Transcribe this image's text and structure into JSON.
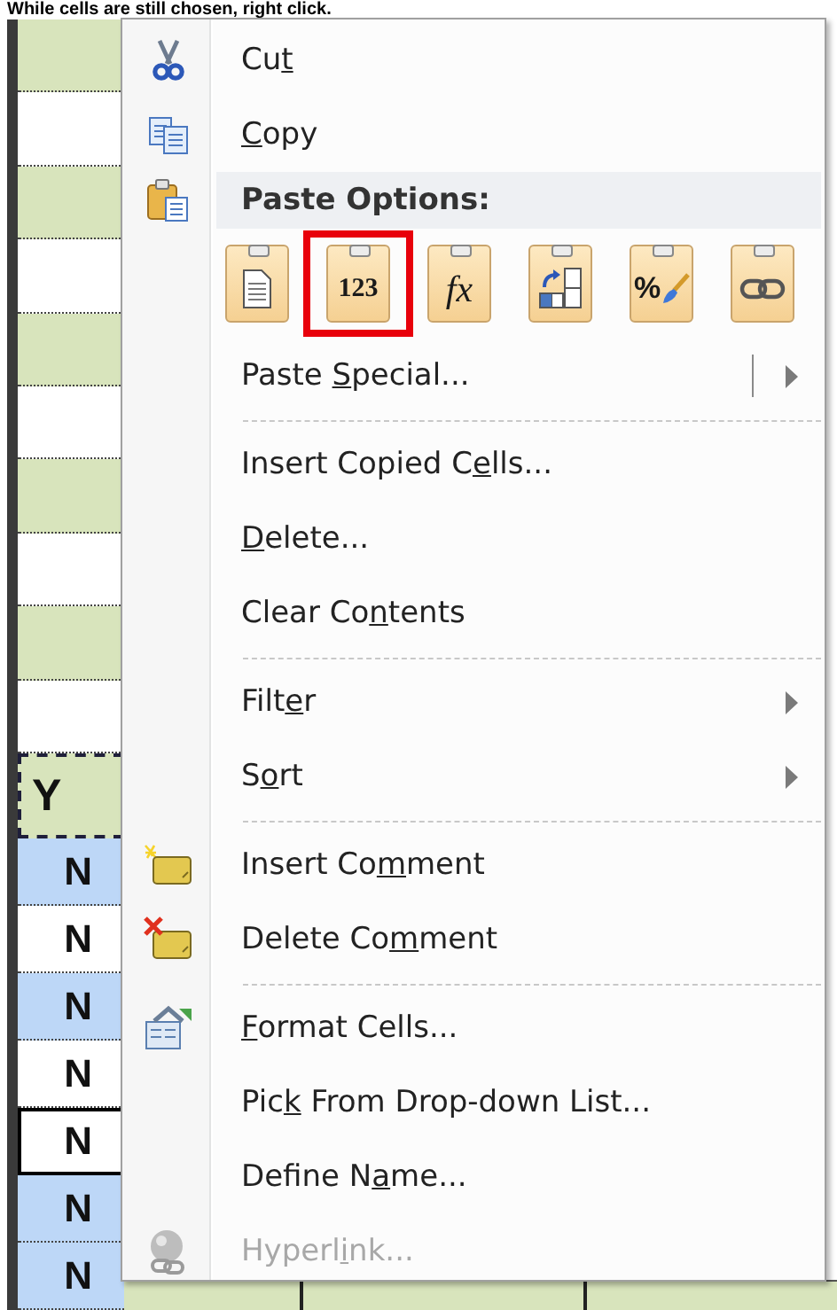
{
  "caption": "While cells are still chosen, right click.",
  "sheet": {
    "rows": [
      {
        "kind": "blank",
        "color": "#d8e4bc",
        "active": false,
        "copied": false
      },
      {
        "kind": "blank",
        "color": "#ffffff",
        "active": false,
        "copied": false
      },
      {
        "kind": "blank",
        "color": "#d8e4bc",
        "active": false,
        "copied": false
      },
      {
        "kind": "blank",
        "color": "#ffffff",
        "active": false,
        "copied": false
      },
      {
        "kind": "blank",
        "color": "#d8e4bc",
        "active": false,
        "copied": false
      },
      {
        "kind": "blank",
        "color": "#ffffff",
        "active": false,
        "copied": false
      },
      {
        "kind": "blank",
        "color": "#d8e4bc",
        "active": false,
        "copied": false
      },
      {
        "kind": "blank",
        "color": "#ffffff",
        "active": false,
        "copied": false
      },
      {
        "kind": "blank",
        "color": "#d8e4bc",
        "active": false,
        "copied": false
      },
      {
        "kind": "blank",
        "color": "#ffffff",
        "active": false,
        "copied": false
      },
      {
        "kind": "header",
        "text": "Y",
        "color": "#d8e4bc",
        "active": false,
        "copied": true
      },
      {
        "kind": "value",
        "text": "N",
        "color": "#bdd7f7",
        "active": false,
        "copied": false
      },
      {
        "kind": "value",
        "text": "N",
        "color": "#ffffff",
        "active": false,
        "copied": false
      },
      {
        "kind": "value",
        "text": "N",
        "color": "#bdd7f7",
        "active": false,
        "copied": false
      },
      {
        "kind": "value",
        "text": "N",
        "color": "#ffffff",
        "active": false,
        "copied": false
      },
      {
        "kind": "value",
        "text": "N",
        "color": "#ffffff",
        "active": true,
        "copied": false
      },
      {
        "kind": "value",
        "text": "N",
        "color": "#bdd7f7",
        "active": false,
        "copied": false
      },
      {
        "kind": "value",
        "text": "N",
        "color": "#bdd7f7",
        "active": false,
        "copied": false
      }
    ]
  },
  "menu": {
    "items": [
      {
        "kind": "command",
        "label": {
          "before": "Cu",
          "key": "t"
        },
        "disabled": false,
        "submenu": false,
        "split": false
      },
      {
        "kind": "command",
        "label": {
          "key": "C",
          "after": "opy"
        },
        "disabled": false,
        "submenu": false,
        "split": false
      },
      {
        "kind": "header",
        "label": "Paste Options:"
      },
      {
        "kind": "paste_options",
        "options": [
          {
            "selected": false
          },
          {
            "selected": true,
            "label": "123"
          },
          {
            "selected": false,
            "label": "fx"
          },
          {
            "selected": false
          },
          {
            "selected": false,
            "label": "%"
          },
          {
            "selected": false
          }
        ]
      },
      {
        "kind": "command",
        "label": {
          "before": "Paste ",
          "key": "S",
          "after": "pecial..."
        },
        "disabled": false,
        "submenu": true,
        "split": true
      },
      {
        "kind": "separator"
      },
      {
        "kind": "command",
        "label": {
          "before": "Insert Copied C",
          "key": "e",
          "after": "lls..."
        },
        "disabled": false,
        "submenu": false,
        "split": false
      },
      {
        "kind": "command",
        "label": {
          "key": "D",
          "after": "elete..."
        },
        "disabled": false,
        "submenu": false,
        "split": false
      },
      {
        "kind": "command",
        "label": {
          "before": "Clear Co",
          "key": "n",
          "after": "tents"
        },
        "disabled": false,
        "submenu": false,
        "split": false
      },
      {
        "kind": "separator"
      },
      {
        "kind": "command",
        "label": {
          "before": "Filt",
          "key": "e",
          "after": "r"
        },
        "disabled": false,
        "submenu": true,
        "split": false
      },
      {
        "kind": "command",
        "label": {
          "before": "S",
          "key": "o",
          "after": "rt"
        },
        "disabled": false,
        "submenu": true,
        "split": false
      },
      {
        "kind": "separator"
      },
      {
        "kind": "command",
        "label": {
          "before": "Insert Co",
          "key": "m",
          "after": "ment"
        },
        "disabled": false,
        "submenu": false,
        "split": false
      },
      {
        "kind": "command",
        "label": {
          "before": "Delete Co",
          "key": "m",
          "after": "ment"
        },
        "disabled": false,
        "submenu": false,
        "split": false
      },
      {
        "kind": "separator"
      },
      {
        "kind": "command",
        "label": {
          "key": "F",
          "after": "ormat Cells..."
        },
        "disabled": false,
        "submenu": false,
        "split": false
      },
      {
        "kind": "command",
        "label": {
          "before": "Pic",
          "key": "k",
          "after": " From Drop-down List..."
        },
        "disabled": false,
        "submenu": false,
        "split": false
      },
      {
        "kind": "command",
        "label": {
          "before": "Define N",
          "key": "a",
          "after": "me..."
        },
        "disabled": false,
        "submenu": false,
        "split": false
      },
      {
        "kind": "command",
        "label": {
          "before": "Hyperl",
          "key": "i",
          "after": "nk..."
        },
        "disabled": true,
        "submenu": false,
        "split": false
      }
    ]
  }
}
